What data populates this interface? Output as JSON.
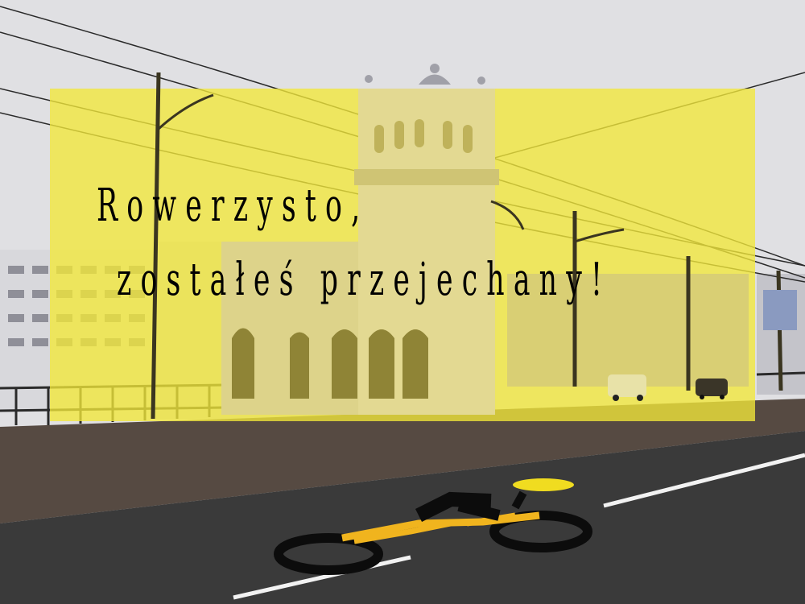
{
  "overlay": {
    "line1": "Rowerzysto,",
    "line2": "zostałeś przejechany!",
    "color": "#f2e83a"
  },
  "scene": {
    "sky_color": "#e2e2e4",
    "asphalt_color": "#3c3c3c",
    "bike_symbol_color": "#f0b41e"
  }
}
